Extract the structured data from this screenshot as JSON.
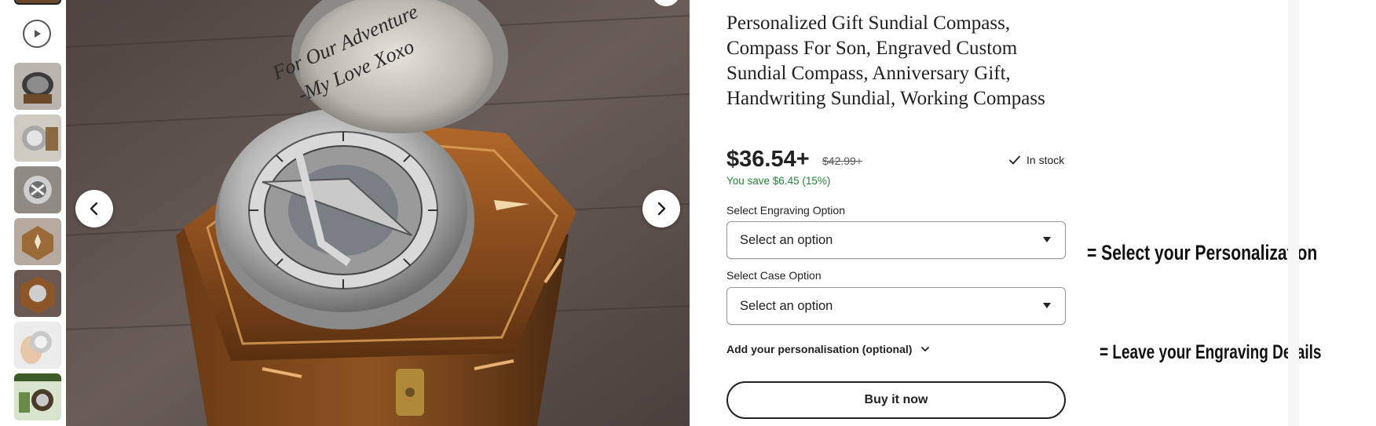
{
  "product": {
    "title": "Personalized Gift Sundial Compass, Compass For Son, Engraved Custom Sundial Compass, Anniversary Gift, Handwriting Sundial, Working Compass",
    "price": "$36.54+",
    "original_price": "$42.99+",
    "stock_status": "In stock",
    "savings": "You save $6.45 (15%)"
  },
  "options": {
    "engraving_label": "Select Engraving Option",
    "engraving_value": "Select an option",
    "case_label": "Select Case Option",
    "case_value": "Select an option"
  },
  "personalisation": {
    "label": "Add your personalisation (optional)"
  },
  "buy": {
    "label": "Buy it now"
  },
  "image": {
    "engraving_line_1": "For Our Adventure",
    "engraving_line_2": "-My Love Xoxo"
  },
  "annotations": {
    "select_note": "= Select your Personalization",
    "engraving_note": "= Leave your Engraving Details"
  },
  "icons": {
    "play": "play-icon",
    "prev": "chevron-left-icon",
    "next": "chevron-right-icon",
    "check": "check-icon",
    "caret": "caret-down-icon",
    "expand": "chevron-down-icon"
  },
  "colors": {
    "savings_green": "#258635",
    "text_dark": "#222222",
    "wood": "#7a4a22",
    "table": "#5a4a44"
  }
}
